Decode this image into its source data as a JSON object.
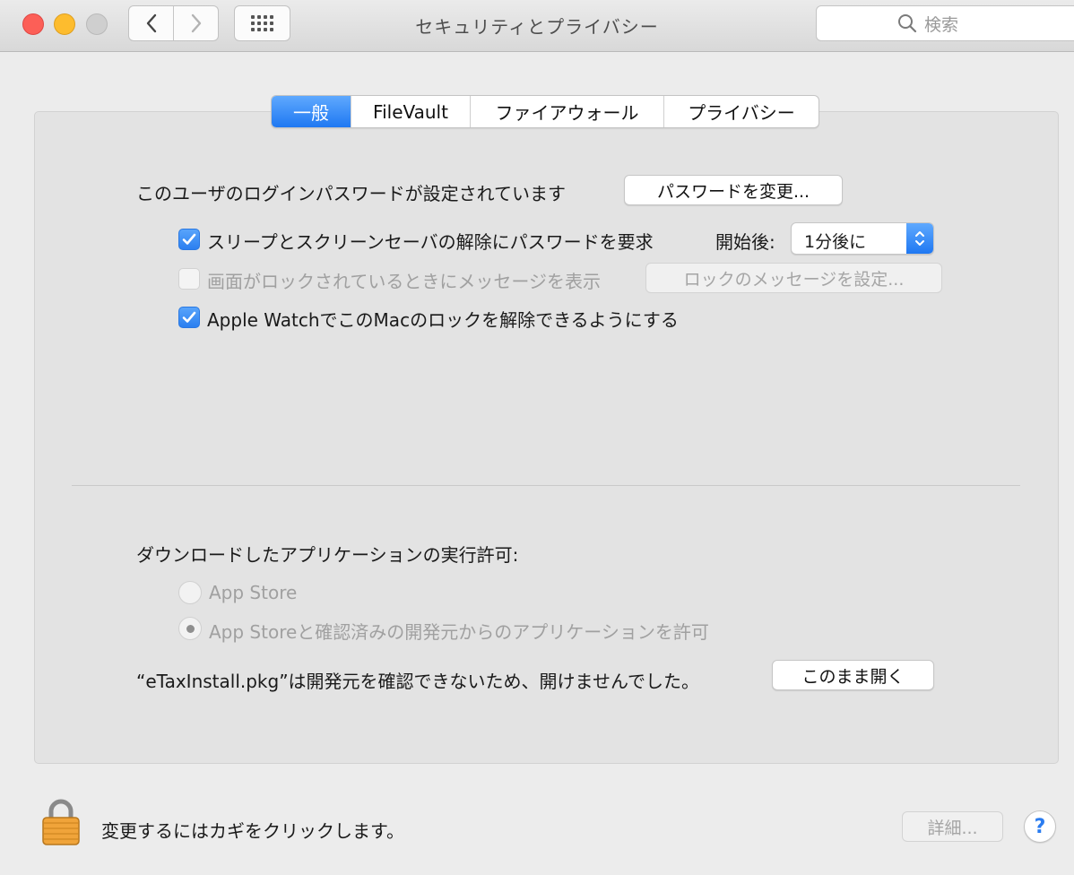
{
  "window": {
    "title": "セキュリティとプライバシー",
    "search_placeholder": "検索"
  },
  "tabs": [
    {
      "label": "一般",
      "active": true
    },
    {
      "label": "FileVault",
      "active": false
    },
    {
      "label": "ファイアウォール",
      "active": false
    },
    {
      "label": "プライバシー",
      "active": false
    }
  ],
  "general": {
    "login_password_text": "このユーザのログインパスワードが設定されています",
    "change_password_button": "パスワードを変更...",
    "require_password": {
      "label": "スリープとスクリーンセーバの解除にパスワードを要求",
      "checked": true,
      "after_label": "開始後:",
      "delay_value": "1分後に"
    },
    "show_message": {
      "label": "画面がロックされているときにメッセージを表示",
      "checked": false,
      "button": "ロックのメッセージを設定..."
    },
    "apple_watch": {
      "label": "Apple WatchでこのMacのロックを解除できるようにする",
      "checked": true
    }
  },
  "downloads": {
    "heading": "ダウンロードしたアプリケーションの実行許可:",
    "options": [
      {
        "label": "App Store",
        "selected": false
      },
      {
        "label": "App Storeと確認済みの開発元からのアプリケーションを許可",
        "selected": true
      }
    ],
    "blocked_message": "“eTaxInstall.pkg”は開発元を確認できないため、開けませんでした。",
    "open_anyway_button": "このまま開く"
  },
  "footer": {
    "lock_text": "変更するにはカギをクリックします。",
    "advanced_button": "詳細...",
    "help_label": "?"
  },
  "colors": {
    "accent": "#2b7ff0",
    "close": "#fc5f57",
    "minimize": "#fdbc2e"
  }
}
